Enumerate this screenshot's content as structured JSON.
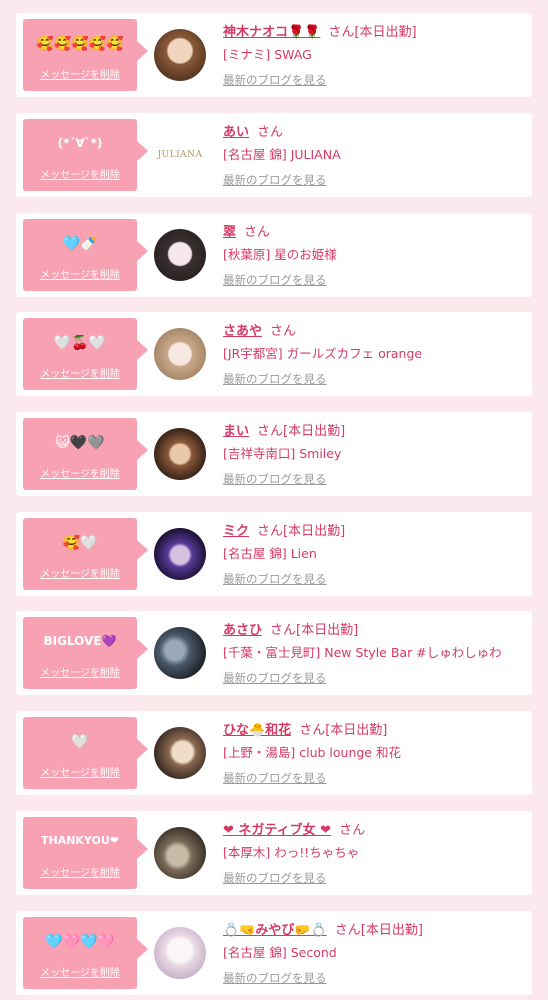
{
  "delete_label": "メッセージを削除",
  "blog_label": "最新のブログを見る",
  "san_label": "さん",
  "working_label": "[本日出勤]",
  "colors": {
    "accent": "#d63a64",
    "bubble": "#f8a1b2",
    "background": "#fbe9ee"
  },
  "items": [
    {
      "message": "🥰🥰🥰🥰🥰",
      "name": "神木ナオコ🌹🌹",
      "working": true,
      "shop": "[ミナミ] SWAG",
      "avatar": "photo",
      "avatar_colors": [
        "#e8c8a8",
        "#5a3a22"
      ]
    },
    {
      "message": "(*´∀`*)",
      "name": "あい",
      "working": false,
      "shop": "[名古屋 錦] JULIANA",
      "avatar": "logo",
      "logo_text": "JULIANA"
    },
    {
      "message": "🩵🍼",
      "name": "翠",
      "working": false,
      "shop": "[秋葉原] 星のお姫様",
      "avatar": "photo",
      "avatar_colors": [
        "#f2e6ea",
        "#3a3030"
      ]
    },
    {
      "message": "🤍🍒🤍",
      "name": "さあや",
      "working": false,
      "shop": "[JR宇都宮] ガールズカフェ orange",
      "avatar": "photo",
      "avatar_colors": [
        "#f3e4dc",
        "#b08e70"
      ]
    },
    {
      "message": "😺🖤🩶",
      "name": "まい",
      "working": true,
      "shop": "[吉祥寺南口] Smiley",
      "avatar": "photo",
      "avatar_colors": [
        "#c89a6a",
        "#3a2418"
      ]
    },
    {
      "message": "🥰🤍",
      "name": "ミク",
      "working": true,
      "shop": "[名古屋 錦] Lien",
      "avatar": "photo",
      "avatar_colors": [
        "#5a3a9a",
        "#1a1030"
      ]
    },
    {
      "message": "BIGLOVE💜",
      "name": "あさひ",
      "working": true,
      "shop": "[千葉・富士見町] New Style Bar #しゅわしゅわ",
      "avatar": "photo",
      "avatar_colors": [
        "#6a7a8a",
        "#20242c"
      ]
    },
    {
      "message": "🤍",
      "name": "ひな🐣和花",
      "working": true,
      "shop": "[上野・湯島] club lounge 和花",
      "avatar": "photo",
      "avatar_colors": [
        "#d8c0a8",
        "#3a2a22"
      ]
    },
    {
      "message": "THANKYOU❤",
      "name": "❤ ネガティブ女 ❤",
      "working": false,
      "shop": "[本厚木] わっ!!ちゃちゃ",
      "avatar": "photo",
      "avatar_colors": [
        "#a89a88",
        "#3a3228"
      ]
    },
    {
      "message": "🩵🩷🩵🩷",
      "name": "💍🤜みやび🤛💍",
      "working": true,
      "shop": "[名古屋 錦] Second",
      "avatar": "photo",
      "avatar_colors": [
        "#f4eef0",
        "#c8b0c8"
      ]
    }
  ]
}
